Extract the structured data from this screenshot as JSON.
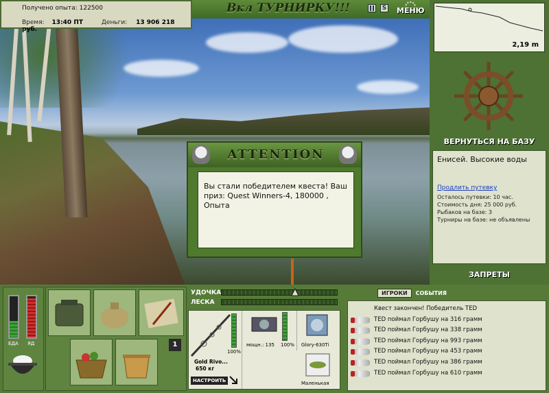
{
  "top_bar": {
    "experience_label": "Получено опыта:",
    "experience_value": "122500",
    "time_label": "Время:",
    "time_value": "13:40 ПТ",
    "money_label": "Деньги:",
    "money_value": "13 906 218 руб.",
    "tournament_title": "Вкл ТУРНИРКУ!!!",
    "menu_label": "МЕНЮ",
    "pause_icon": "pause-icon",
    "speed_icon": "s-icon"
  },
  "depth": {
    "value": "2,19 m"
  },
  "right_panel": {
    "return_label": "Вернуться на базу",
    "location_title": "Енисей. Высокие воды",
    "extend_link": "Продлить путевку",
    "info_lines": [
      "Осталось путевки: 10 час.",
      "Стоимость дня: 25 000 руб.",
      "Рыбаков на базе: 3",
      "Турниры на базе: не объявлены"
    ],
    "bans_label": "ЗАПРЕТЫ"
  },
  "dialog": {
    "title": "ATTENTION",
    "message": "Вы стали победителем квеста! Ваш приз: Quest Winners-4, 180000 , Опыта"
  },
  "meters": {
    "food_label": "ЕДА",
    "food_level": 0.4,
    "poison_label": "ЯД",
    "poison_level": 0.95
  },
  "inventory": {
    "page": "1",
    "slots": [
      "bag-icon",
      "sack-icon",
      "map-icon",
      "basket-icon",
      "bucket-icon"
    ]
  },
  "tackle": {
    "rod_label": "УДОЧКА",
    "line_label": "ЛЕСКА",
    "rod_name": "Gold Rivo...",
    "rod_weight": "650 кг",
    "rod_percent": "100%",
    "reel_power": "мощн.: 135",
    "reel_percent": "100%",
    "line_name": "Glory-630Ti",
    "lure_name": "Маленькая",
    "setup_label": "НАСТРОИТЬ"
  },
  "chat": {
    "tab_players": "ИГРОКИ",
    "tab_events": "СОБЫТИЯ",
    "lines": [
      "Квест закончен! Победитель TED",
      "TED поймал Горбушу на 316 грамм",
      "TED поймал Горбушу на 338 грамм",
      "TED поймал Горбушу на 993 грамм",
      "TED поймал Горбушу на 453 грамм",
      "TED поймал Горбушу на 386 грамм",
      "TED поймал Горбушу на 610 грамм"
    ]
  }
}
